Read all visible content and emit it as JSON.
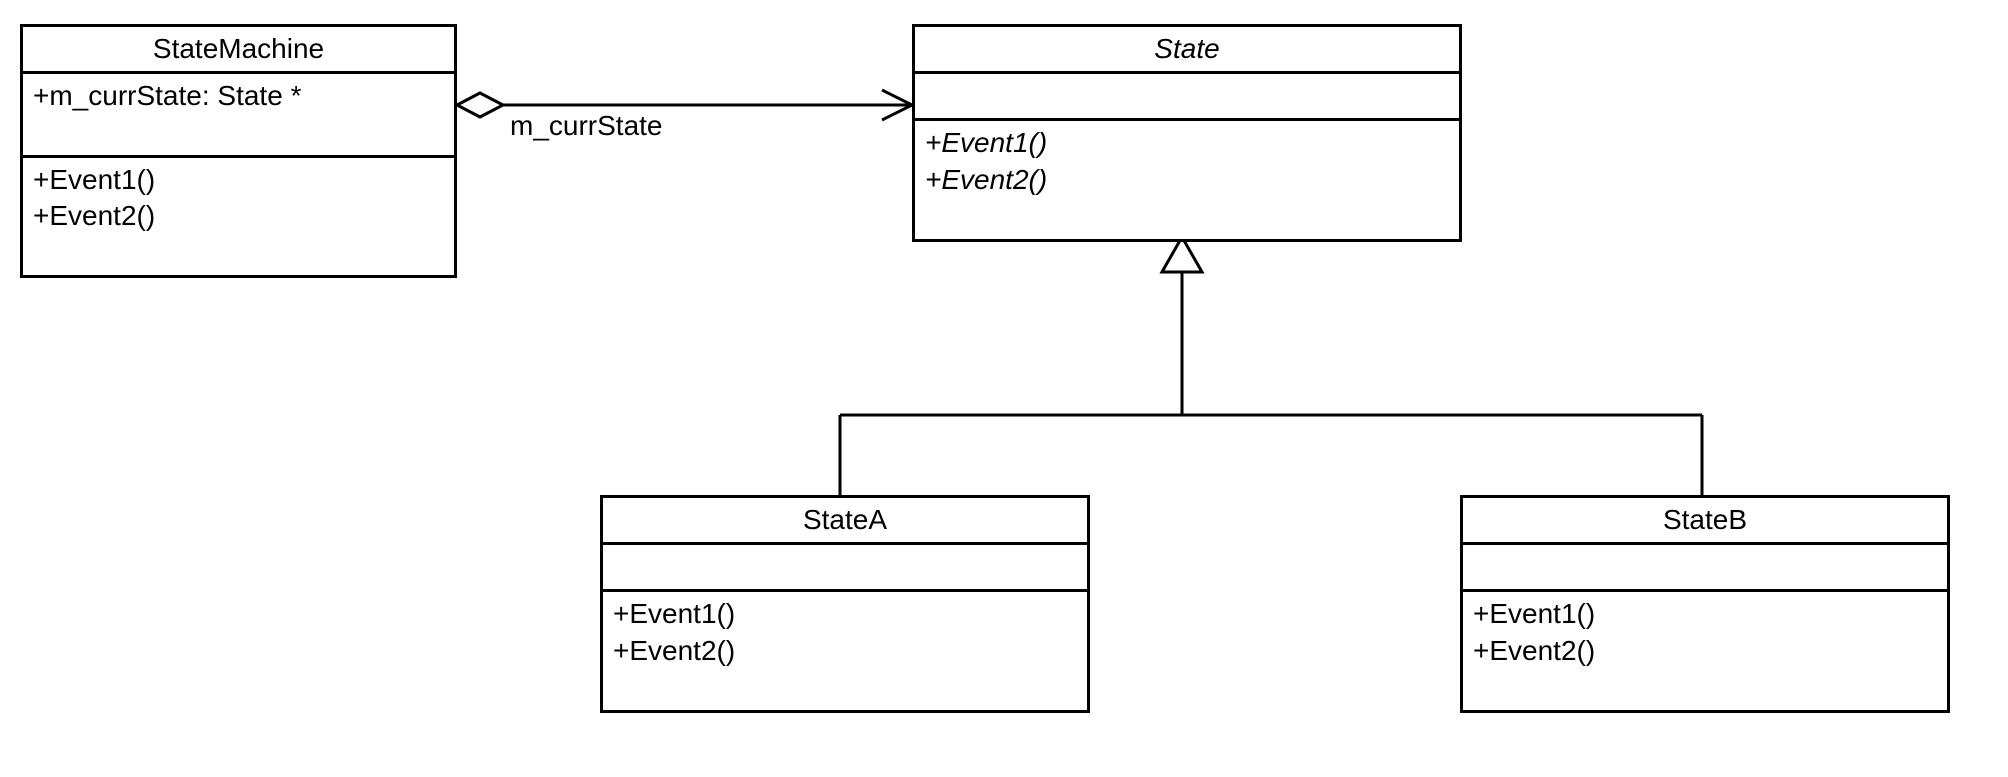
{
  "classes": {
    "stateMachine": {
      "name": "StateMachine",
      "attrs": [
        "+m_currState: State *"
      ],
      "ops": [
        "+Event1()",
        "+Event2()"
      ]
    },
    "state": {
      "name": "State",
      "attrs": [],
      "ops": [
        "+Event1()",
        "+Event2()"
      ]
    },
    "stateA": {
      "name": "StateA",
      "attrs": [],
      "ops": [
        "+Event1()",
        "+Event2()"
      ]
    },
    "stateB": {
      "name": "StateB",
      "attrs": [],
      "ops": [
        "+Event1()",
        "+Event2()"
      ]
    }
  },
  "assocLabel": "m_currState"
}
